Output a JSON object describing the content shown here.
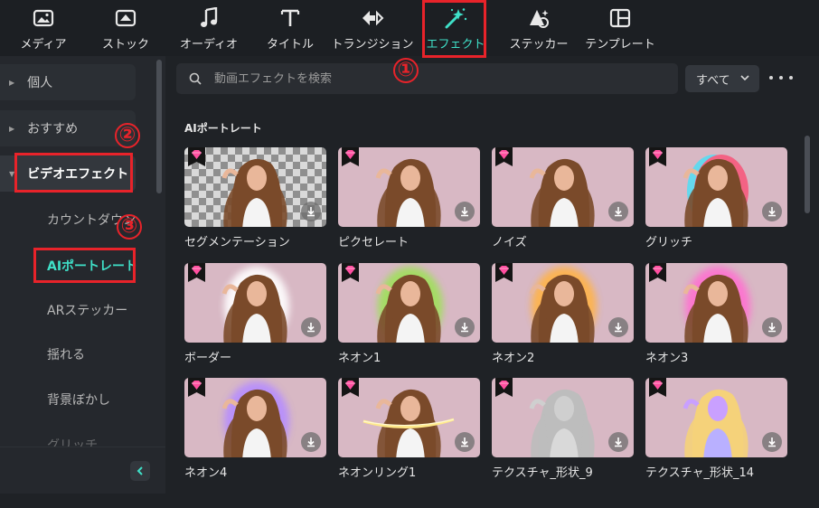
{
  "toolbar": {
    "items": [
      {
        "label": "メディア",
        "icon": "media-icon"
      },
      {
        "label": "ストック",
        "icon": "stock-icon"
      },
      {
        "label": "オーディオ",
        "icon": "music-note-icon"
      },
      {
        "label": "タイトル",
        "icon": "title-t-icon"
      },
      {
        "label": "トランジション",
        "icon": "transition-icon"
      },
      {
        "label": "エフェクト",
        "icon": "magic-wand-icon"
      },
      {
        "label": "ステッカー",
        "icon": "sticker-icon"
      },
      {
        "label": "テンプレート",
        "icon": "template-icon"
      }
    ],
    "active_color": "#3fe0c8"
  },
  "annotations": {
    "step1": "①",
    "step2": "②",
    "step3": "③",
    "color": "#e8232a"
  },
  "sidebar": {
    "parents": [
      {
        "label": "個人"
      },
      {
        "label": "おすすめ"
      },
      {
        "label": "ビデオエフェクト"
      }
    ],
    "subitems": [
      {
        "label": "カウントダウン"
      },
      {
        "label": "AIポートレート"
      },
      {
        "label": "ARステッカー"
      },
      {
        "label": "揺れる"
      },
      {
        "label": "背景ぼかし"
      },
      {
        "label": "グリッチ"
      }
    ],
    "collapse_label": "<"
  },
  "search": {
    "placeholder": "動画エフェクトを検索"
  },
  "filter": {
    "label": "すべて"
  },
  "section": {
    "title": "AIポートレート"
  },
  "cards": [
    {
      "label": "セグメンテーション",
      "style": "checker"
    },
    {
      "label": "ピクセレート",
      "style": "plain"
    },
    {
      "label": "ノイズ",
      "style": "plain"
    },
    {
      "label": "グリッチ",
      "style": "glitch"
    },
    {
      "label": "ボーダー",
      "style": "border"
    },
    {
      "label": "ネオン1",
      "style": "neon-green"
    },
    {
      "label": "ネオン2",
      "style": "neon-orange"
    },
    {
      "label": "ネオン3",
      "style": "neon-pink"
    },
    {
      "label": "ネオン4",
      "style": "neon-purple"
    },
    {
      "label": "ネオンリング1",
      "style": "ring"
    },
    {
      "label": "テクスチャ_形状_9",
      "style": "texture-gray"
    },
    {
      "label": "テクスチャ_形状_14",
      "style": "texture-color"
    }
  ]
}
